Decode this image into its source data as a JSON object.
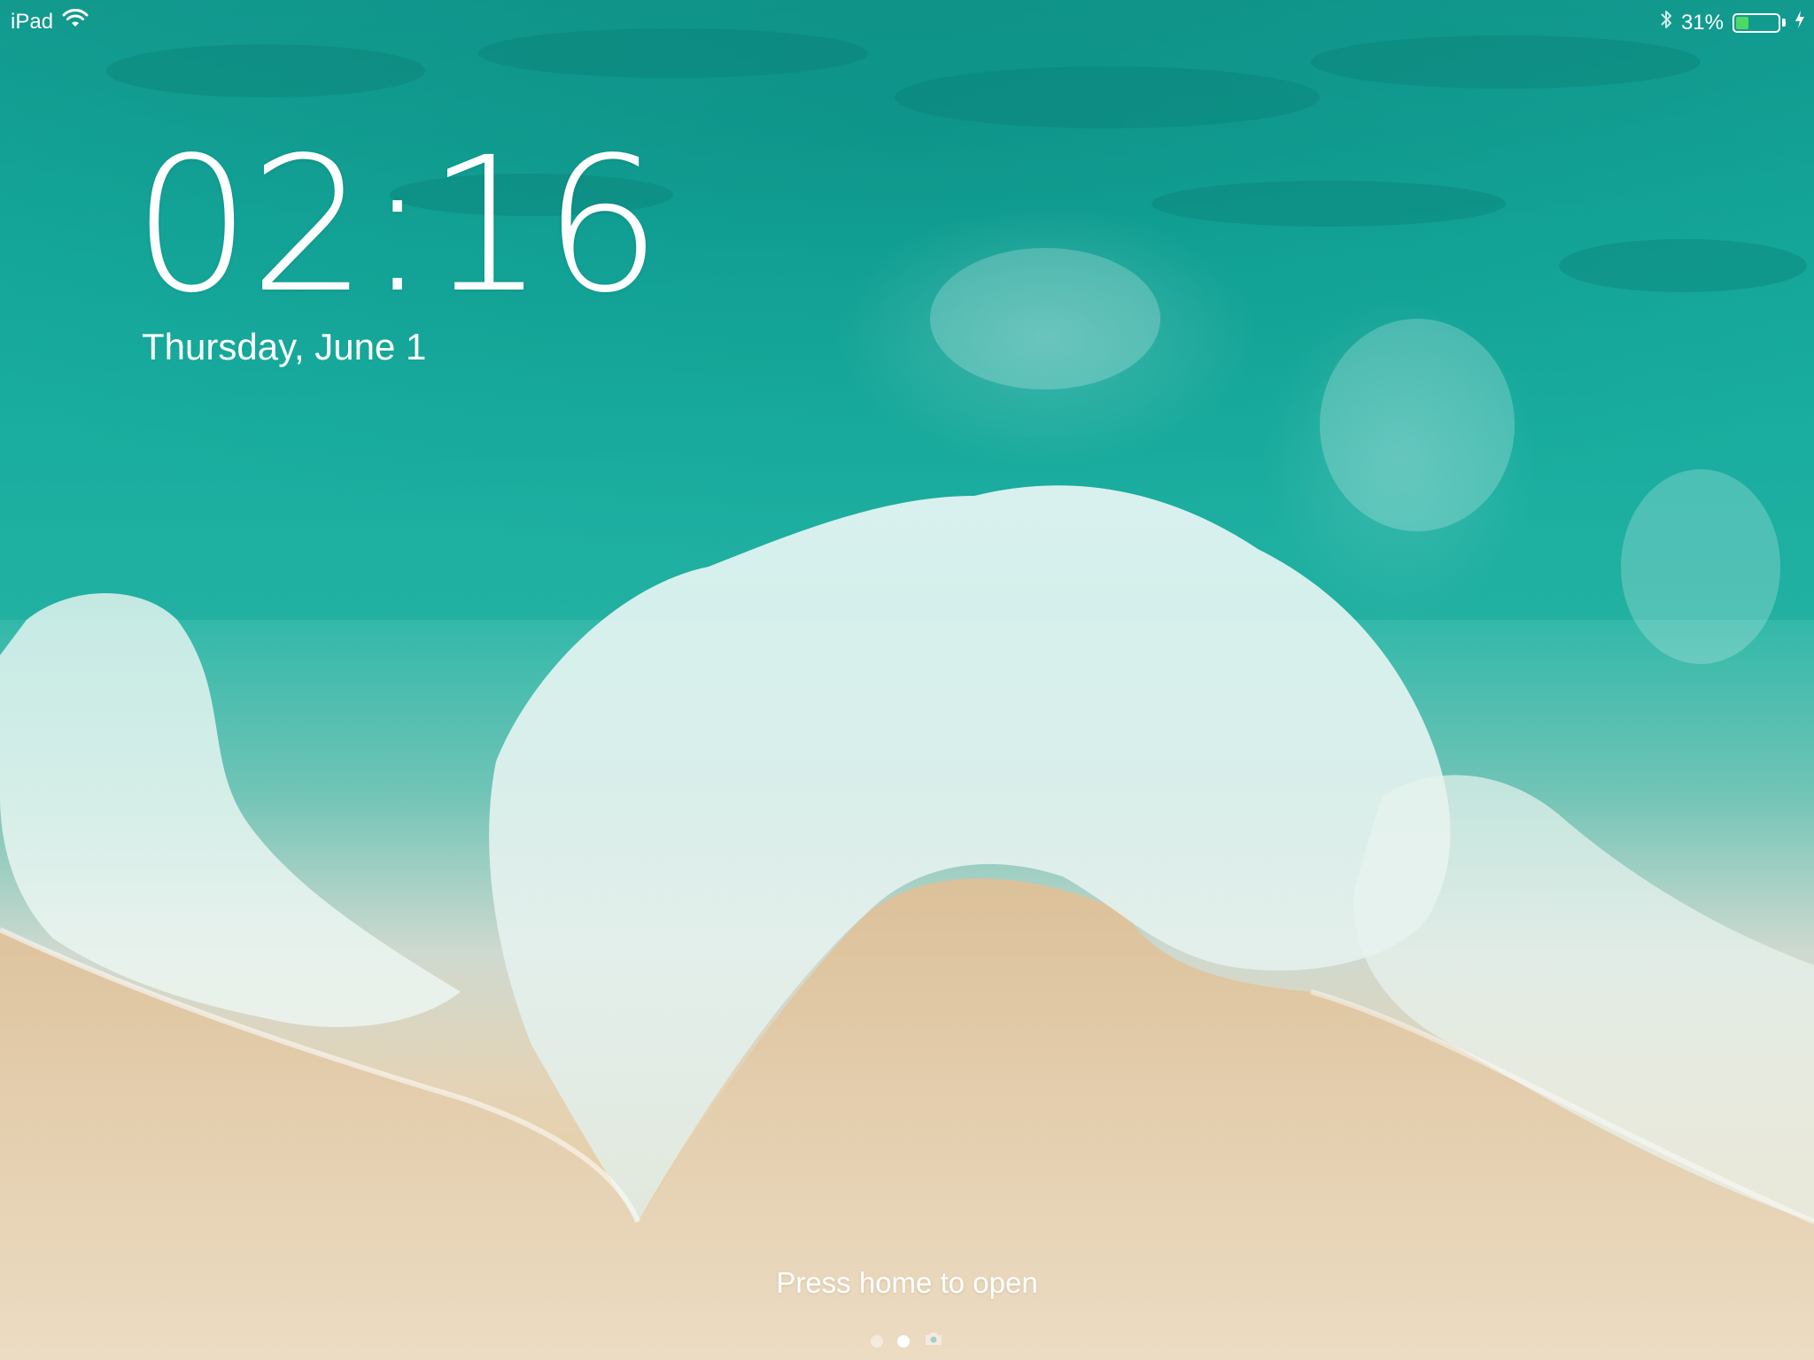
{
  "status_bar": {
    "device_name": "iPad",
    "wifi_icon": "wifi-icon",
    "bluetooth_icon": "bluetooth-icon",
    "battery_percent_text": "31%",
    "battery_level": 0.31,
    "battery_fill_color": "#4cd964",
    "charging_icon": "charging-bolt-icon"
  },
  "lock_screen": {
    "time": "02:16",
    "date": "Thursday, June 1",
    "unlock_hint": "Press home to open",
    "wallpaper": "ocean-beach-wallpaper"
  },
  "page_indicator": {
    "pages": [
      "widgets-page",
      "lock-page",
      "camera-page"
    ],
    "active_index": 1,
    "camera_icon": "camera-icon"
  }
}
